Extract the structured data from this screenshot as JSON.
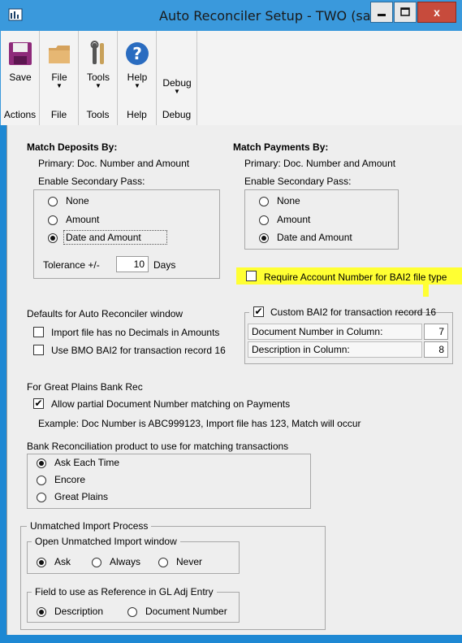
{
  "window": {
    "title": "Auto Reconciler Setup  -  TWO (sa)",
    "close_label": "x"
  },
  "ribbon": {
    "buttons": [
      {
        "label": "Save",
        "icon": "save-icon",
        "group": "Actions"
      },
      {
        "label": "File",
        "icon": "folder-icon",
        "group": "File"
      },
      {
        "label": "Tools",
        "icon": "tools-icon",
        "group": "Tools"
      },
      {
        "label": "Help",
        "icon": "help-icon",
        "group": "Help"
      },
      {
        "label": "Debug",
        "icon": "",
        "group": "Debug"
      }
    ]
  },
  "deposits": {
    "heading": "Match Deposits By:",
    "primary": "Primary: Doc. Number and Amount",
    "secondary_label": "Enable Secondary Pass:",
    "options": [
      "None",
      "Amount",
      "Date and Amount"
    ],
    "selected": "Date and Amount",
    "tolerance_label": "Tolerance +/-",
    "tolerance_value": "10",
    "tolerance_unit": "Days"
  },
  "payments": {
    "heading": "Match Payments By:",
    "primary": "Primary: Doc. Number and Amount",
    "secondary_label": "Enable Secondary Pass:",
    "options": [
      "None",
      "Amount",
      "Date and Amount"
    ],
    "selected": "Date and Amount"
  },
  "bai2_account": {
    "label": "Require Account Number for BAI2 file type",
    "checked": false,
    "highlight_color": "#ffff33"
  },
  "defaults": {
    "heading": "Defaults for Auto Reconciler window",
    "no_decimals": "Import file has no Decimals in Amounts",
    "bmo_bai2": "Use BMO BAI2 for transaction record 16"
  },
  "custom_bai2": {
    "label": "Custom BAI2 for transaction record 16",
    "checked": true,
    "doc_col_label": "Document Number in Column:",
    "doc_col_value": "7",
    "desc_col_label": "Description in Column:",
    "desc_col_value": "8"
  },
  "gp_bank_rec": {
    "heading": "For Great Plains Bank Rec",
    "partial": "Allow partial Document Number matching on Payments",
    "partial_checked": true,
    "example": "Example: Doc Number is ABC999123, Import file has 123, Match will occur"
  },
  "bank_product": {
    "heading": "Bank Reconciliation product to use for matching transactions",
    "options": [
      "Ask Each Time",
      "Encore",
      "Great Plains"
    ],
    "selected": "Ask Each Time"
  },
  "unmatched": {
    "heading": "Unmatched Import Process",
    "open_window_heading": "Open Unmatched Import window",
    "open_options": [
      "Ask",
      "Always",
      "Never"
    ],
    "open_selected": "Ask",
    "ref_heading": "Field to use as Reference in GL Adj Entry",
    "ref_options": [
      "Description",
      "Document Number"
    ],
    "ref_selected": "Description"
  }
}
